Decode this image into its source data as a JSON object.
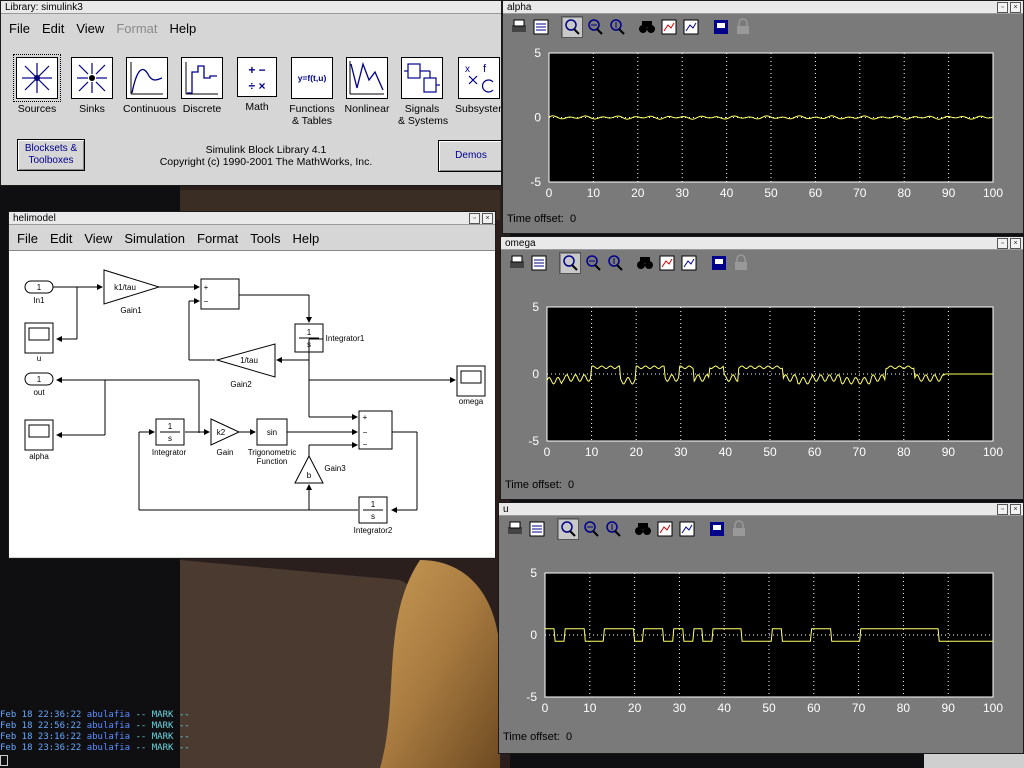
{
  "library": {
    "title": "Library: simulink3",
    "menu": [
      "File",
      "Edit",
      "View",
      "Format",
      "Help"
    ],
    "menu_disabled": [
      false,
      false,
      false,
      true,
      false
    ],
    "blocks": [
      {
        "label": "Sources",
        "icon": "sources-icon"
      },
      {
        "label": "Sinks",
        "icon": "sinks-icon"
      },
      {
        "label": "Continuous",
        "icon": "continuous-icon"
      },
      {
        "label": "Discrete",
        "icon": "discrete-icon"
      },
      {
        "label": "Math",
        "icon": "math-icon",
        "glyph": "+ −\n÷ ×"
      },
      {
        "label": "Functions\n& Tables",
        "icon": "functions-icon",
        "glyph": "y=f(t,u)"
      },
      {
        "label": "Nonlinear",
        "icon": "nonlinear-icon"
      },
      {
        "label": "Signals\n& Systems",
        "icon": "signals-icon"
      },
      {
        "label": "Subsystems",
        "icon": "subsystems-icon"
      }
    ],
    "blocksets_button": "Blocksets &\nToolboxes",
    "info_line1": "Simulink Block Library 4.1",
    "info_line2": "Copyright (c) 1990-2001 The MathWorks, Inc.",
    "demos_button": "Demos"
  },
  "model": {
    "title": "helimodel",
    "menu": [
      "File",
      "Edit",
      "View",
      "Simulation",
      "Format",
      "Tools",
      "Help"
    ],
    "blocks": {
      "in1": "1",
      "in1_label": "In1",
      "gain1": "k1/tau",
      "gain1_label": "Gain1",
      "sum_top_plus": "+",
      "sum_top_minus": "−",
      "integrator1_num": "1",
      "integrator1_den": "s",
      "integrator1_label": "Integrator1",
      "gain2": "1/tau",
      "gain2_label": "Gain2",
      "u_label": "u",
      "out_port": "1",
      "out_label": "out",
      "omega_label": "omega",
      "alpha_label": "alpha",
      "integrator_num": "1",
      "integrator_den": "s",
      "integrator_label": "Integrator",
      "gain": "k2",
      "gain_label": "Gain",
      "trig": "sin",
      "trig_label1": "Trigonometric",
      "trig_label2": "Function",
      "gain3": "b",
      "gain3_label": "Gain3",
      "sum2_plus": "+",
      "sum2_minus1": "−",
      "sum2_minus2": "−",
      "integrator2_num": "1",
      "integrator2_den": "s",
      "integrator2_label": "Integrator2"
    }
  },
  "scopes": [
    {
      "title": "alpha",
      "offset_label": "Time offset:",
      "offset_value": "0",
      "signal": "flat"
    },
    {
      "title": "omega",
      "offset_label": "Time offset:",
      "offset_value": "0",
      "signal": "omega"
    },
    {
      "title": "u",
      "offset_label": "Time offset:",
      "offset_value": "0",
      "signal": "square"
    }
  ],
  "chart_data": {
    "type": "line",
    "x_ticks": [
      "0",
      "10",
      "20",
      "30",
      "40",
      "50",
      "60",
      "70",
      "80",
      "90",
      "100"
    ],
    "y_ticks": [
      "5",
      "0",
      "-5"
    ],
    "xlim": [
      0,
      100
    ],
    "ylim": [
      -5,
      5
    ],
    "grid": true,
    "background": "#000000",
    "line_color": "#ffff66",
    "frame_color": "#ffffff"
  },
  "terminal": {
    "lines": [
      {
        "date": "Feb 18 22:36:22",
        "host": "abulafia",
        "msg": "-- MARK --"
      },
      {
        "date": "Feb 18 22:56:22",
        "host": "abulafia",
        "msg": "-- MARK --"
      },
      {
        "date": "Feb 18 23:16:22",
        "host": "abulafia",
        "msg": "-- MARK --"
      },
      {
        "date": "Feb 18 23:36:22",
        "host": "abulafia",
        "msg": "-- MARK --"
      }
    ]
  },
  "colors": {
    "window_bg": "#d6d6d6",
    "scope_bg": "#7a7a7a",
    "plot_bg": "#000000",
    "trace": "#ffff66",
    "button_text": "#00008b"
  }
}
